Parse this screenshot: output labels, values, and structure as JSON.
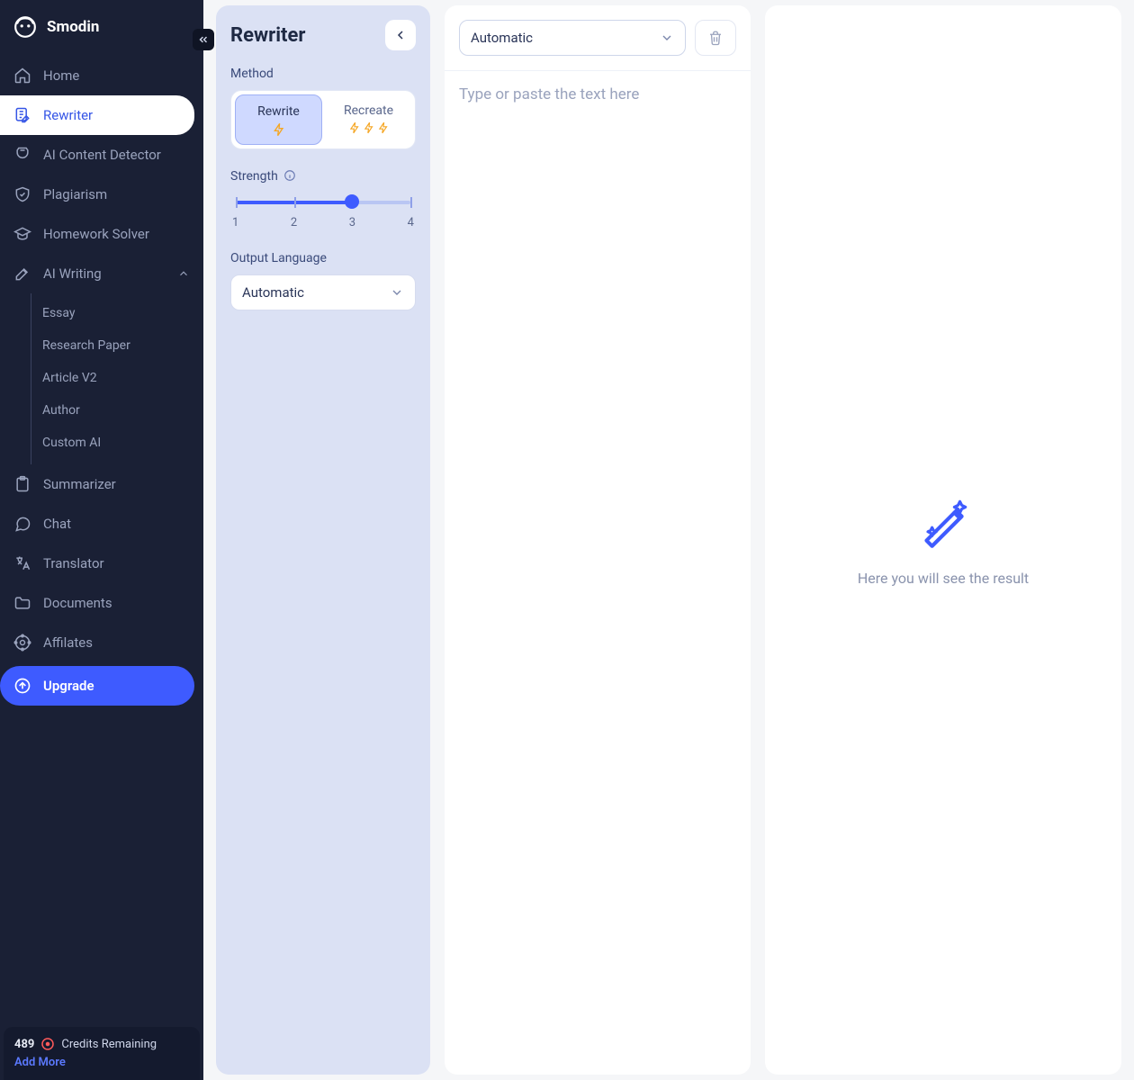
{
  "brand": {
    "name": "Smodin"
  },
  "sidebar": {
    "items": {
      "home": "Home",
      "rewriter": "Rewriter",
      "detector": "AI Content Detector",
      "plagiarism": "Plagiarism",
      "homework": "Homework Solver",
      "aiwriting": "AI Writing",
      "summarizer": "Summarizer",
      "chat": "Chat",
      "translator": "Translator",
      "documents": "Documents",
      "affilates": "Affilates",
      "upgrade": "Upgrade"
    },
    "sub_aiwriting": {
      "essay": "Essay",
      "research": "Research Paper",
      "article": "Article V2",
      "author": "Author",
      "custom": "Custom AI"
    }
  },
  "credits": {
    "count": "489",
    "label": "Credits Remaining",
    "add_more": "Add More"
  },
  "settings": {
    "title": "Rewriter",
    "method_label": "Method",
    "method_rewrite": "Rewrite",
    "method_recreate": "Recreate",
    "strength_label": "Strength",
    "strength_value": 3,
    "strength_ticks": {
      "t1": "1",
      "t2": "2",
      "t3": "3",
      "t4": "4"
    },
    "output_lang_label": "Output Language",
    "output_lang_value": "Automatic"
  },
  "input": {
    "lang_value": "Automatic",
    "placeholder": "Type or paste the text here"
  },
  "output": {
    "empty_text": "Here you will see the result"
  },
  "colors": {
    "accent": "#3e5bff",
    "sidebar_bg": "#1a2035",
    "panel_bg": "#dbe1f4"
  }
}
